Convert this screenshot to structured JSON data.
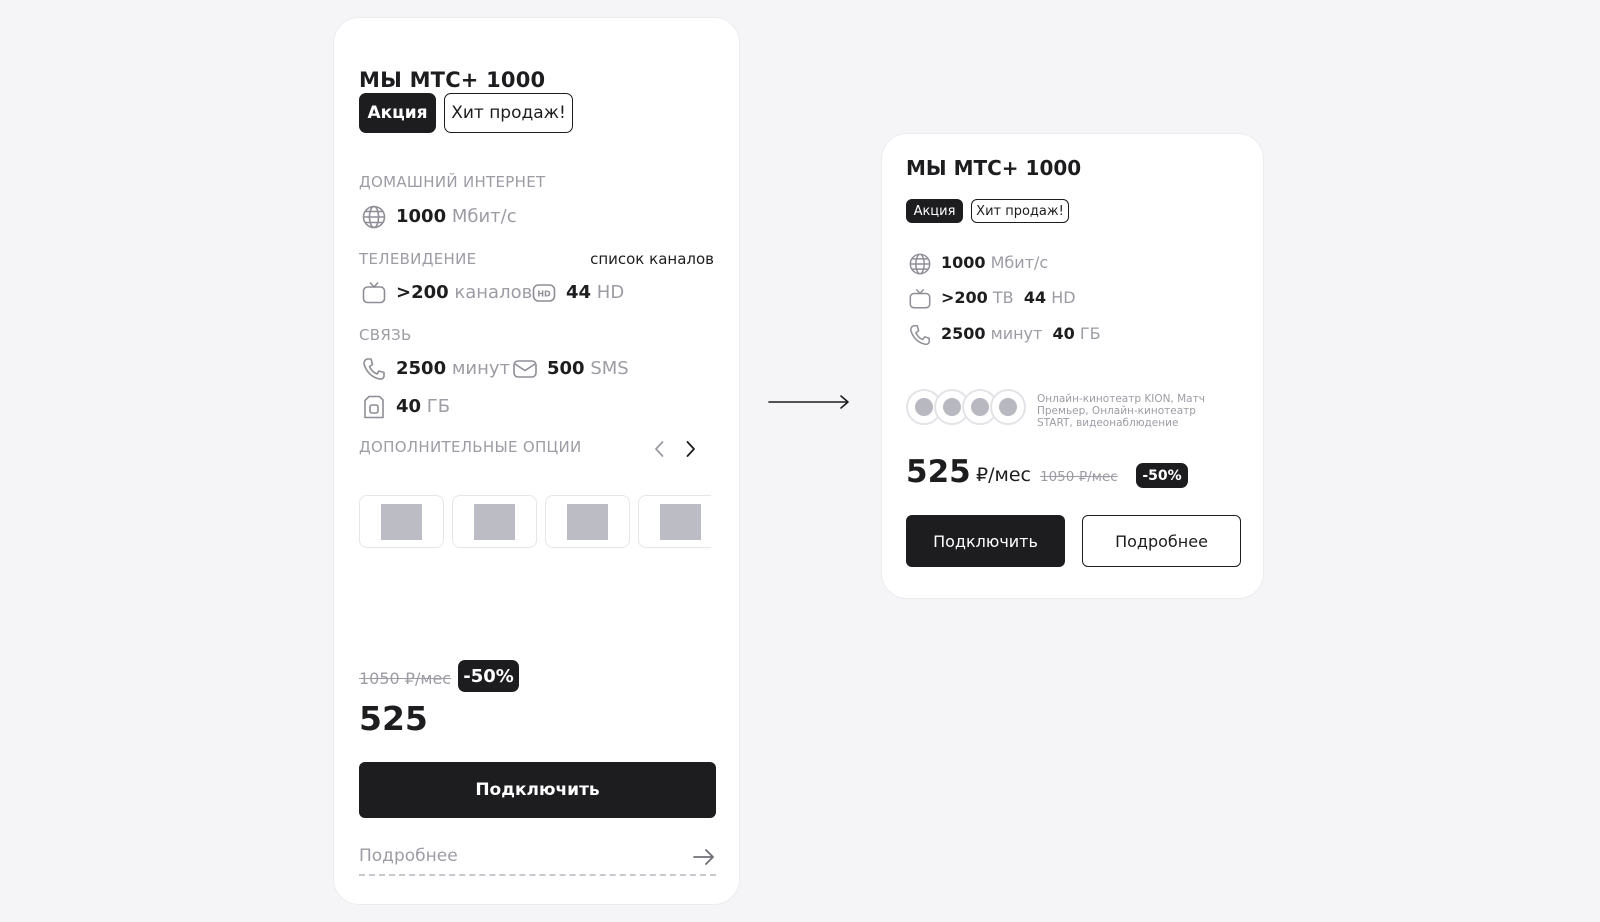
{
  "colors": {
    "dark": "#1d1d20",
    "muted": "#9c9ca4",
    "background": "#f5f5f8",
    "card": "#ffffff"
  },
  "card_full": {
    "title": "МЫ МТС+ 1000",
    "tags": [
      "Акция",
      "Хит продаж!"
    ],
    "sections": {
      "internet": "ДОМАШНИЙ ИНТЕРНЕТ",
      "tv": "ТЕЛЕВИДЕНИЕ",
      "connection": "СВЯЗЬ",
      "options": "ДОПОЛНИТЕЛЬНЫЕ ОПЦИИ"
    },
    "channels_link": "список каналов",
    "internet": {
      "value": "1000",
      "unit": "Мбит/с",
      "icon": "globe-icon"
    },
    "tv_channels": {
      "value": ">200",
      "unit": "каналов",
      "icon": "tv-icon"
    },
    "tv_hd": {
      "value": "44",
      "unit": "HD",
      "icon": "hd-icon"
    },
    "minutes": {
      "value": "2500",
      "unit": "минут",
      "icon": "phone-icon"
    },
    "sms": {
      "value": "500",
      "unit": "SMS",
      "icon": "mail-icon"
    },
    "data": {
      "value": "40",
      "unit": "ГБ",
      "icon": "sim-icon"
    },
    "old_price": "1050 ₽/мес",
    "discount": "-50%",
    "price": "525",
    "connect_button": "Подключить",
    "more_link": "Подробнее"
  },
  "card_compact": {
    "title": "МЫ МТС+ 1000",
    "tags": [
      "Акция",
      "Хит продаж!"
    ],
    "internet": {
      "value": "1000",
      "unit": "Мбит/с"
    },
    "tv_channels": {
      "value": ">200",
      "unit": "ТВ"
    },
    "tv_hd": {
      "value": "44",
      "unit": "HD"
    },
    "minutes": {
      "value": "2500",
      "unit": "минут"
    },
    "data": {
      "value": "40",
      "unit": "ГБ"
    },
    "services": "Онлайн-кинотеатр KION, Матч Премьер, Онлайн-кинотеатр START, видеонаблюдение",
    "price": "525",
    "price_unit": "₽/мес",
    "old_price": "1050 ₽/мес",
    "discount": "-50%",
    "connect_button": "Подключить",
    "more_button": "Подробнее"
  }
}
